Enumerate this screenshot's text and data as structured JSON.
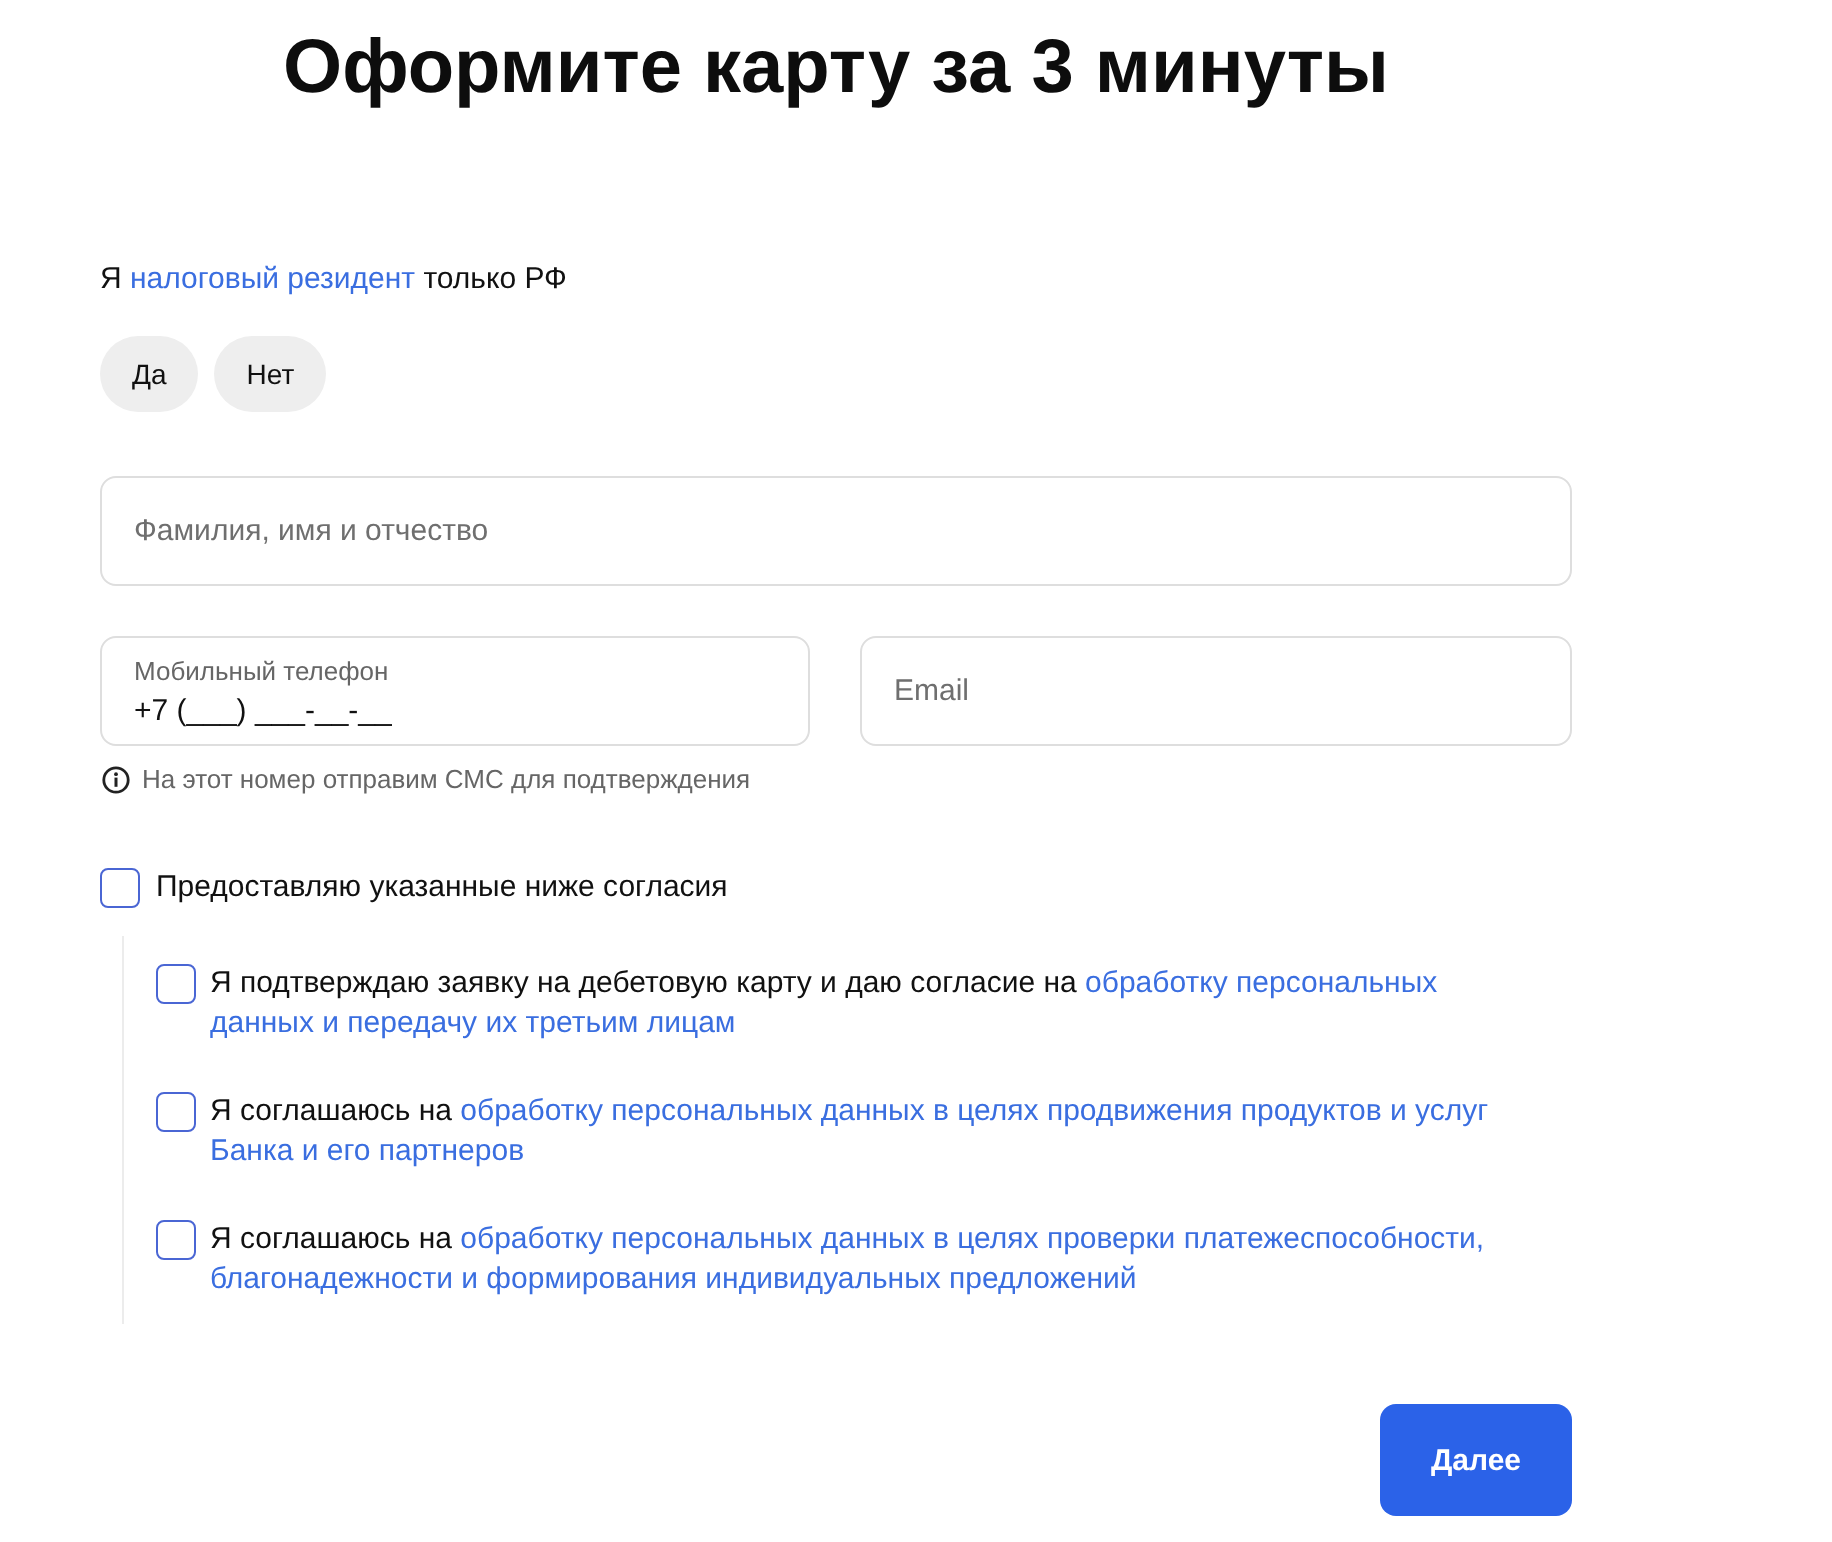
{
  "title": "Оформите карту за 3 минуты",
  "residency": {
    "prefix": "Я",
    "link": "налоговый резидент",
    "suffix": "только РФ",
    "options": [
      {
        "label": "Да",
        "selected": false
      },
      {
        "label": "Нет",
        "selected": false
      }
    ]
  },
  "full_name": {
    "placeholder": "Фамилия, имя и отчество"
  },
  "phone": {
    "label": "Мобильный телефон",
    "value": "+7 (___) ___-__-__",
    "hint": "На этот номер отправим СМС для подтверждения"
  },
  "email": {
    "placeholder": "Email"
  },
  "consents": {
    "master": {
      "label": "Предоставляю указанные ниже согласия",
      "checked": false
    },
    "items": [
      {
        "text": "Я подтверждаю заявку на дебетовую карту и даю согласие на",
        "link_lines": [
          "обработку персональных",
          "данных и передачу их третьим лицам"
        ],
        "checked": false
      },
      {
        "text": "Я соглашаюсь на",
        "link_lines": [
          "обработку персональных данных в целях продвижения продуктов и услуг",
          "Банка и его партнеров"
        ],
        "checked": false
      },
      {
        "text": "Я соглашаюсь на",
        "link_lines": [
          "обработку персональных данных в целях проверки платежеспособности,",
          "благонадежности и формирования индивидуальных предложений"
        ],
        "checked": false
      }
    ]
  },
  "submit_button": "Далее"
}
